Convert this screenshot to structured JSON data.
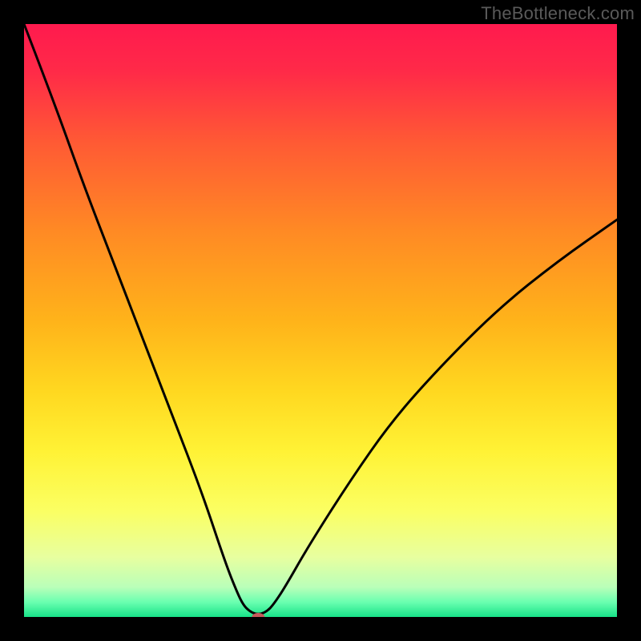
{
  "watermark_text": "TheBottleneck.com",
  "chart_data": {
    "type": "line",
    "title": "",
    "xlabel": "",
    "ylabel": "",
    "xlim": [
      0,
      100
    ],
    "ylim": [
      0,
      100
    ],
    "grid": false,
    "legend": false,
    "series": [
      {
        "name": "bottleneck-curve",
        "x": [
          0,
          5,
          10,
          15,
          20,
          25,
          30,
          34,
          36,
          37,
          38,
          39,
          40,
          41,
          42,
          44,
          48,
          55,
          62,
          70,
          80,
          90,
          100
        ],
        "y": [
          100,
          87,
          73,
          60,
          47,
          34,
          21,
          9,
          4,
          2,
          1,
          0.5,
          0.5,
          1,
          2,
          5,
          12,
          23,
          33,
          42,
          52,
          60,
          67
        ]
      }
    ],
    "marker": {
      "name": "optimal-point",
      "x": 39.5,
      "y": 0.0,
      "color": "#c65a5a",
      "rx": 8,
      "ry": 5
    },
    "background_gradient": {
      "stops": [
        {
          "offset": 0.0,
          "color": "#ff1a4e"
        },
        {
          "offset": 0.08,
          "color": "#ff2a48"
        },
        {
          "offset": 0.2,
          "color": "#ff5a34"
        },
        {
          "offset": 0.35,
          "color": "#ff8a24"
        },
        {
          "offset": 0.5,
          "color": "#ffb31a"
        },
        {
          "offset": 0.62,
          "color": "#ffd820"
        },
        {
          "offset": 0.72,
          "color": "#fff235"
        },
        {
          "offset": 0.82,
          "color": "#fbff62"
        },
        {
          "offset": 0.9,
          "color": "#e7ffa0"
        },
        {
          "offset": 0.95,
          "color": "#b9ffb9"
        },
        {
          "offset": 0.975,
          "color": "#6affb0"
        },
        {
          "offset": 1.0,
          "color": "#18e288"
        }
      ]
    }
  }
}
